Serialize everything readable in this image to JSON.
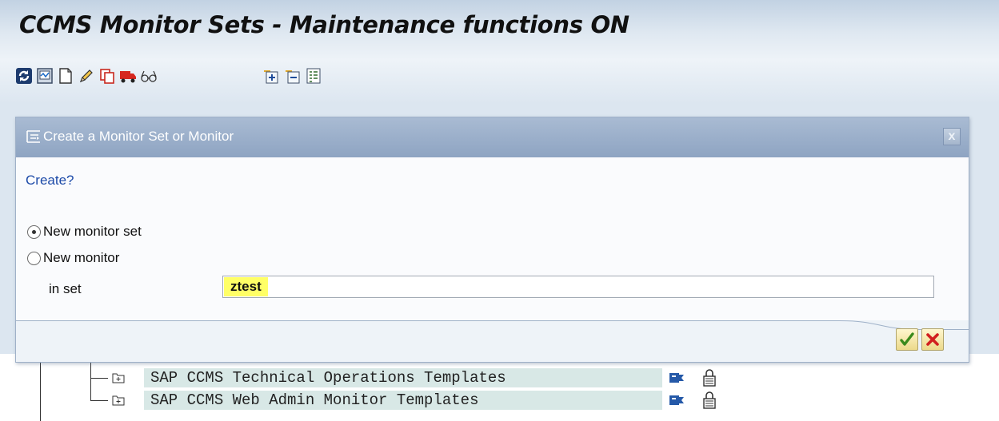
{
  "window": {
    "title": "CCMS Monitor Sets - Maintenance functions ON"
  },
  "toolbar": {
    "icons": [
      "refresh-icon",
      "monitor-icon",
      "new-document-icon",
      "edit-pencil-icon",
      "copy-icon",
      "transport-icon",
      "glasses-icon",
      "expand-subtree-icon",
      "collapse-subtree-icon",
      "legend-icon"
    ]
  },
  "tree": {
    "rows": [
      {
        "label": "SAP CCMS Technical Operations Templates"
      },
      {
        "label": "SAP CCMS Web Admin Monitor Templates"
      }
    ]
  },
  "dialog": {
    "title": "Create a Monitor Set or Monitor",
    "close_label": "x",
    "question": "Create?",
    "options": [
      {
        "label": "New monitor set",
        "selected": true
      },
      {
        "label": "New monitor",
        "selected": false
      }
    ],
    "in_set_label": "in set",
    "in_set_value": "ztest",
    "buttons": {
      "confirm": "check-icon",
      "cancel": "cancel-x-icon"
    }
  },
  "colors": {
    "header_gradient": "#c2d2e3",
    "dialog_header": "#9ab0cb",
    "question_text": "#1c4aa8",
    "highlight": "#ffff66",
    "tree_row_bg": "#d8e8e6"
  }
}
